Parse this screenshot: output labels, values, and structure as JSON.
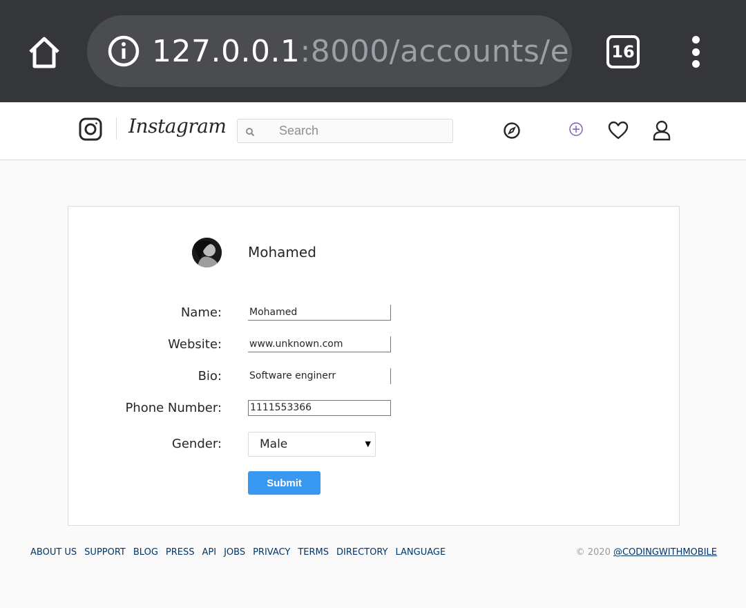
{
  "browser": {
    "url_host": "127.0.0.1",
    "url_rest": ":8000/accounts/e",
    "tab_count": "16",
    "icons": [
      "home-icon",
      "info-icon",
      "tabs-icon",
      "more-vert-icon"
    ],
    "colors": {
      "chrome_bg": "#35363a",
      "url_bar_bg": "#4a4c50"
    }
  },
  "header": {
    "wordmark": "Instagram",
    "search_placeholder": "Search",
    "icons": [
      "instagram-logo-icon",
      "search-icon",
      "explore-compass-icon",
      "add-post-icon",
      "heart-icon",
      "profile-icon"
    ]
  },
  "profile": {
    "username": "Mohamed"
  },
  "form": {
    "name_label": "Name:",
    "name_value": "Mohamed",
    "website_label": "Website:",
    "website_value": "www.unknown.com",
    "bio_label": "Bio:",
    "bio_value": "Software enginerr",
    "phone_label": "Phone Number:",
    "phone_value": "1111553366",
    "gender_label": "Gender:",
    "gender_value": "Male",
    "submit_label": "Submit",
    "accent_color": "#3897f0"
  },
  "footer": {
    "links": [
      "ABOUT US",
      "SUPPORT",
      "BLOG",
      "PRESS",
      "API",
      "JOBS",
      "PRIVACY",
      "TERMS",
      "DIRECTORY",
      "LANGUAGE"
    ],
    "copyright_prefix": "© 2020",
    "copyright_link": "@CODINGWITHMOBILE"
  }
}
